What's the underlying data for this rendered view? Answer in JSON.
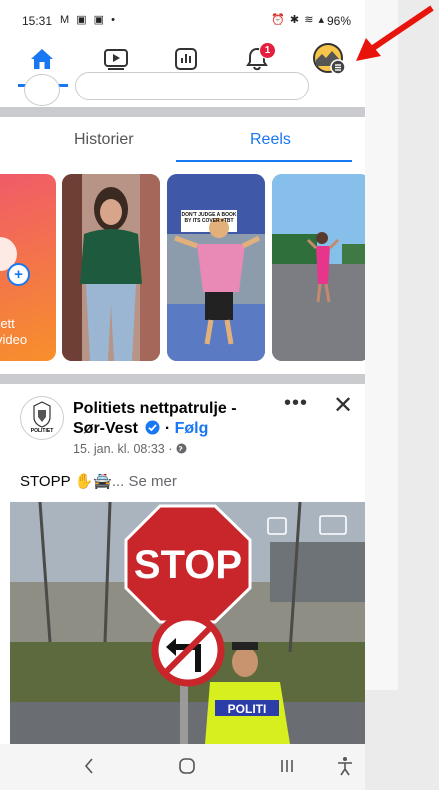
{
  "status_bar": {
    "time": "15:31",
    "left_icons": "M ▣ ▣ •",
    "right_icons": "⏰ ✱ ≋ ▴",
    "battery": "96%"
  },
  "nav": {
    "active": "home",
    "notification_count": "1",
    "accent": "#1877f2"
  },
  "tabs": {
    "stories": "Historier",
    "reels": "Reels",
    "active": "Reels"
  },
  "reels": {
    "create_line1": "rett",
    "create_line2": "video",
    "reel3_sign": "DON'T JUDGE A BOOK BY ITS COVER #TBT"
  },
  "post": {
    "page_name": "Politiets nettpatrulje - Sør-Vest",
    "separator": " · ",
    "follow": "Følg",
    "date": "15. jan. kl. 08:33 · ",
    "text": "STOPP ✋🚔",
    "see_more": "... Se mer",
    "more": "•••",
    "close": "✕",
    "avatar_label": "POLITIET",
    "image_stop": "STOP",
    "image_vest": "POLITI"
  },
  "annotation": {
    "arrow_color": "#e8140c"
  }
}
